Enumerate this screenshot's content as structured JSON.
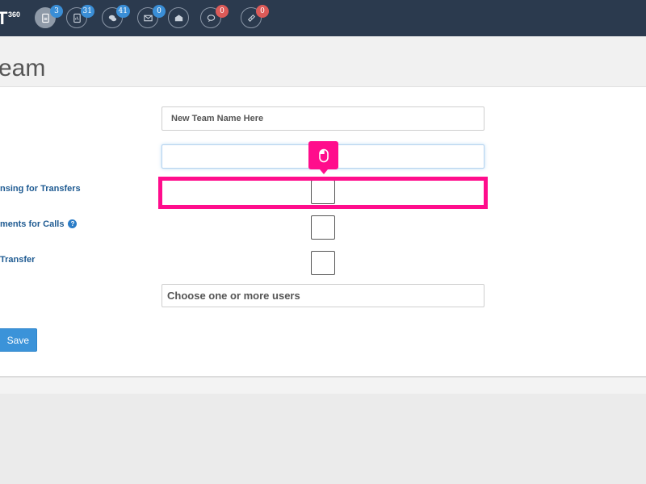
{
  "app": {
    "brand_text": "T",
    "brand_sup": "360"
  },
  "nav": [
    {
      "icon": "document-icon",
      "badge": "3",
      "badge_color": "#3a8ed6",
      "active": true
    },
    {
      "icon": "report-icon",
      "badge": "31",
      "badge_color": "#3a8ed6"
    },
    {
      "icon": "chat-bubbles-icon",
      "badge": "41",
      "badge_color": "#3a8ed6"
    },
    {
      "icon": "envelope-icon",
      "badge": "0",
      "badge_color": "#3a8ed6"
    },
    {
      "icon": "open-envelope-icon",
      "badge": "",
      "badge_color": ""
    },
    {
      "icon": "speech-bubble-icon",
      "badge": "0",
      "badge_color": "#dc5a58"
    },
    {
      "icon": "ticket-icon",
      "badge": "0",
      "badge_color": "#dc5a58"
    }
  ],
  "page": {
    "title": "eam"
  },
  "form": {
    "team_name_placeholder": "New Team Name Here",
    "second_field_value": "",
    "label_transfers": "nsing for Transfers",
    "label_calls": "ments for Calls",
    "help_glyph": "?",
    "label_transfer": "Transfer",
    "users_placeholder": "Choose one or more users",
    "save_label": "Save"
  },
  "colors": {
    "highlight": "#ff0d8c",
    "topbar": "#2b3a4e",
    "label": "#1f5b92",
    "primary": "#3b93d9"
  }
}
